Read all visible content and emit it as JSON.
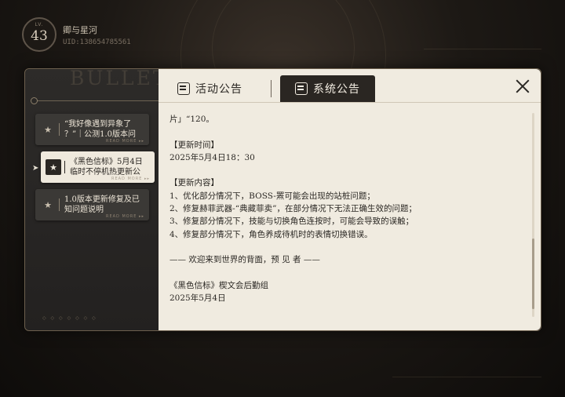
{
  "player": {
    "level": "43",
    "level_prefix": "LV.",
    "name": "卿与星河",
    "uid": "UID:138654785561"
  },
  "watermark": "BULLETIN",
  "tabs": [
    {
      "label": "活动公告",
      "active": false
    },
    {
      "label": "系统公告",
      "active": true
    }
  ],
  "notices": [
    {
      "title": "“我好像遇到异象了\n？”｜公测1.0版本问",
      "more": "READ MORE ▸▸"
    },
    {
      "title": "《黑色信标》5月4日\n临时不停机热更新公",
      "more": "READ MORE ▸▸",
      "active": true
    },
    {
      "title": "1.0版本更新修复及已\n知问题说明",
      "more": "READ MORE ▸▸"
    }
  ],
  "sidebar_footer": "◇ ◇ ◇ ◇ ◇ ◇ ◇",
  "article": {
    "lines": [
      "片」“120。",
      "",
      "【更新时间】",
      "2025年5月4日18：30",
      "",
      "【更新内容】",
      "1、优化部分情况下，BOSS-罴可能会出现的站桩问题；",
      "2、修复赫菲武器-“典藏菲卖”，在部分情况下无法正确生效的问题；",
      "3、修复部分情况下，技能与切换角色连按时，可能会导致的误触；",
      "4、修复部分情况下，角色养成待机时的表情切换错误。",
      "",
      "—— 欢迎来到世界的背面，预 见 者 ——",
      "",
      "《黑色信标》楔文会后勤组",
      "2025年5月4日"
    ]
  },
  "colors": {
    "panel_bg": "#1d1c1b",
    "content_bg": "#f0ebe0",
    "tab_active_bg": "#2a2622",
    "accent_gold": "#6d604e"
  }
}
